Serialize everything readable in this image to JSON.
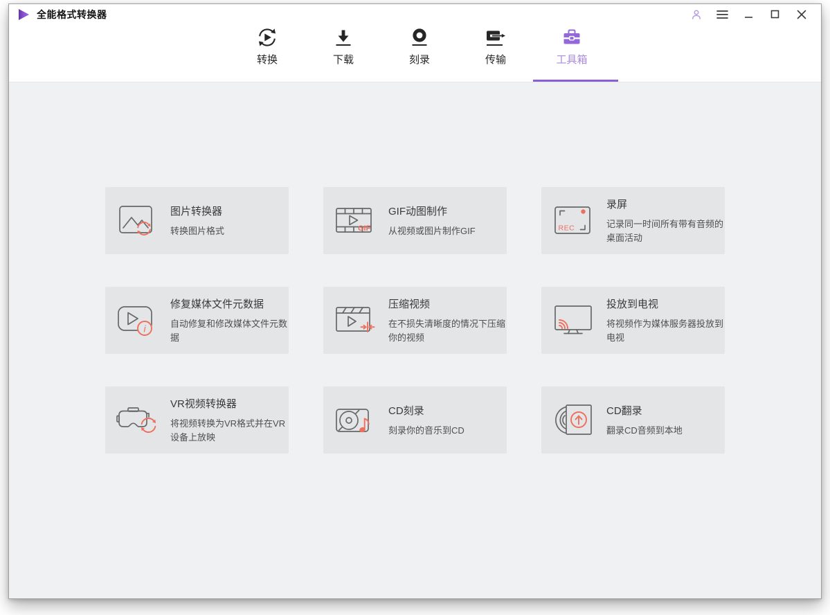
{
  "window": {
    "title": "全能格式转换器",
    "controls": {
      "account": "account",
      "menu": "menu",
      "minimize": "minimize",
      "maximize": "maximize",
      "close": "close"
    }
  },
  "nav": {
    "items": [
      {
        "label": "转换",
        "icon": "convert-icon",
        "active": false
      },
      {
        "label": "下载",
        "icon": "download-icon",
        "active": false
      },
      {
        "label": "刻录",
        "icon": "burn-icon",
        "active": false
      },
      {
        "label": "传输",
        "icon": "transfer-icon",
        "active": false
      },
      {
        "label": "工具箱",
        "icon": "toolbox-icon",
        "active": true
      }
    ]
  },
  "toolbox": {
    "cards": [
      {
        "title": "图片转换器",
        "subtitle": "转换图片格式",
        "icon": "image-converter-icon"
      },
      {
        "title": "GIF动图制作",
        "subtitle": "从视频或图片制作GIF",
        "icon": "gif-maker-icon"
      },
      {
        "title": "录屏",
        "subtitle": "记录同一时间所有带有音频的桌面活动",
        "icon": "screen-record-icon"
      },
      {
        "title": "修复媒体文件元数据",
        "subtitle": "自动修复和修改媒体文件元数据",
        "icon": "fix-metadata-icon"
      },
      {
        "title": "压缩视频",
        "subtitle": "在不损失清晰度的情况下压缩你的视频",
        "icon": "compress-video-icon"
      },
      {
        "title": "投放到电视",
        "subtitle": "将视频作为媒体服务器投放到电视",
        "icon": "cast-to-tv-icon"
      },
      {
        "title": "VR视频转换器",
        "subtitle": "将视频转换为VR格式并在VR设备上放映",
        "icon": "vr-converter-icon"
      },
      {
        "title": "CD刻录",
        "subtitle": "刻录你的音乐到CD",
        "icon": "cd-burn-icon"
      },
      {
        "title": "CD翻录",
        "subtitle": "翻录CD音频到本地",
        "icon": "cd-rip-icon"
      }
    ]
  },
  "icon_texts": {
    "rec": "REC",
    "gif": "GIF",
    "info": "i"
  },
  "colors": {
    "accent_purple": "#8a5fd6",
    "accent_purple_light": "#a98ae0",
    "accent_coral": "#ed6f5e",
    "content_bg": "#f0f1f2",
    "card_bg": "#e4e5e6"
  }
}
